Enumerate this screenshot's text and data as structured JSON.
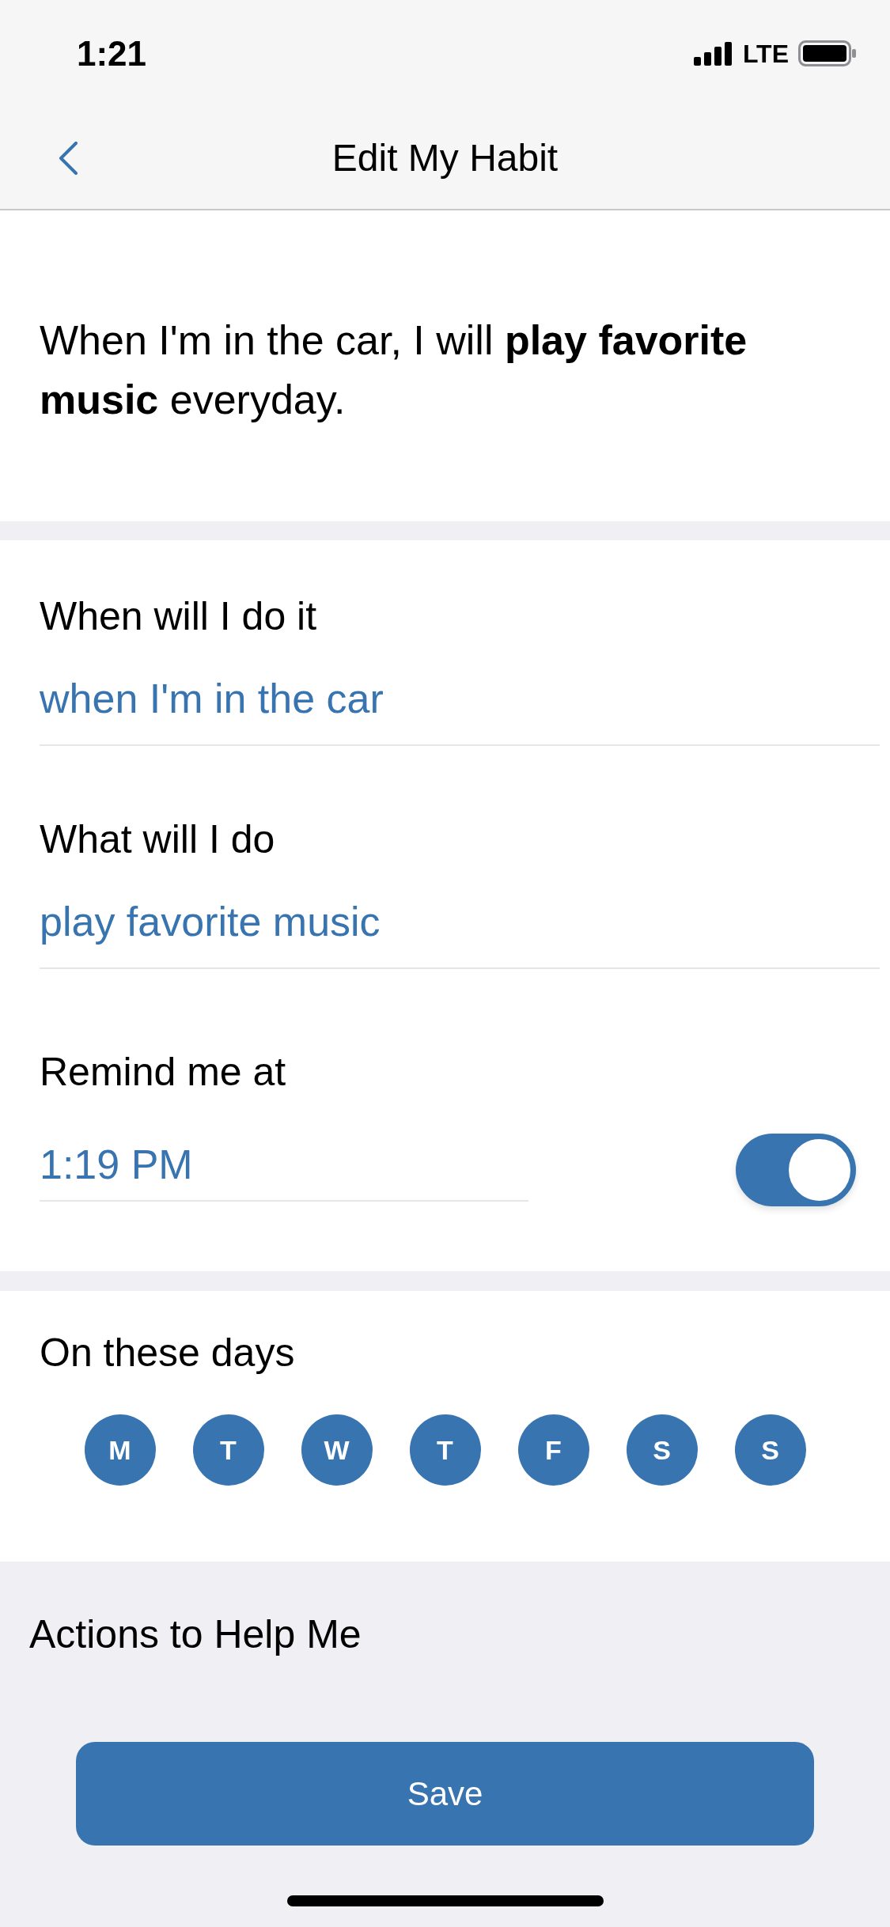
{
  "status_bar": {
    "time": "1:21",
    "network": "LTE"
  },
  "nav": {
    "title": "Edit My Habit"
  },
  "summary": "When I'm in the car, I will **play favorite music** everyday.",
  "fields": [
    {
      "label": "When will I do it",
      "value": "when I'm in the car"
    },
    {
      "label": "What will I do",
      "value": "play favorite music"
    }
  ],
  "reminder": {
    "label": "Remind me at",
    "value": "1:19 PM",
    "on": true
  },
  "days": {
    "label": "On these days",
    "items": [
      {
        "label": "M",
        "selected": true
      },
      {
        "label": "T",
        "selected": true
      },
      {
        "label": "W",
        "selected": true
      },
      {
        "label": "T",
        "selected": true
      },
      {
        "label": "F",
        "selected": true
      },
      {
        "label": "S",
        "selected": true
      },
      {
        "label": "S",
        "selected": true
      }
    ]
  },
  "actions": {
    "title": "Actions to Help Me"
  },
  "save_button": "Save"
}
